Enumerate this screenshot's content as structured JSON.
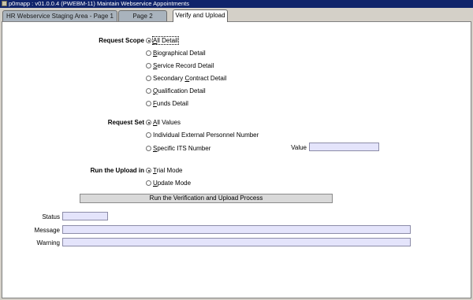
{
  "window": {
    "title": "p0mapp : v01.0.0.4 (PWEBM-11) Maintain Webservice Appointments",
    "icon": "app-icon"
  },
  "tabs": [
    {
      "label": "HR Webservice Staging Area - Page 1",
      "active": false
    },
    {
      "label": "Page 2",
      "active": false
    },
    {
      "label": "Verify and Upload",
      "active": true
    }
  ],
  "request_scope": {
    "label": "Request Scope",
    "options": [
      {
        "mnemonic": "A",
        "rest": "ll Detail",
        "checked": true
      },
      {
        "mnemonic": "B",
        "rest": "iographical Detail",
        "checked": false
      },
      {
        "mnemonic": "S",
        "rest": "ervice Record Detail",
        "checked": false
      },
      {
        "pre": "Secondary ",
        "mnemonic": "C",
        "rest": "ontract Detail",
        "checked": false
      },
      {
        "mnemonic": "Q",
        "rest": "ualification Detail",
        "checked": false
      },
      {
        "mnemonic": "F",
        "rest": "unds Detail",
        "checked": false
      }
    ]
  },
  "request_set": {
    "label": "Request Set",
    "options": [
      {
        "mnemonic": "A",
        "rest": "ll Values",
        "checked": true
      },
      {
        "mnemonic": "",
        "rest": "Individual External Personnel Number",
        "checked": false
      },
      {
        "mnemonic": "S",
        "rest": "pecific ITS Number",
        "checked": false
      }
    ],
    "value_label": "Value",
    "value": ""
  },
  "upload_mode": {
    "label": "Run the Upload in",
    "options": [
      {
        "mnemonic": "T",
        "rest": "rial Mode",
        "checked": true
      },
      {
        "mnemonic": "U",
        "rest": "pdate Mode",
        "checked": false
      }
    ]
  },
  "run_button_label": "Run the Verification and Upload Process",
  "status": {
    "label": "Status",
    "value": ""
  },
  "message": {
    "label": "Message",
    "value": ""
  },
  "warning": {
    "label": "Warning",
    "value": ""
  }
}
